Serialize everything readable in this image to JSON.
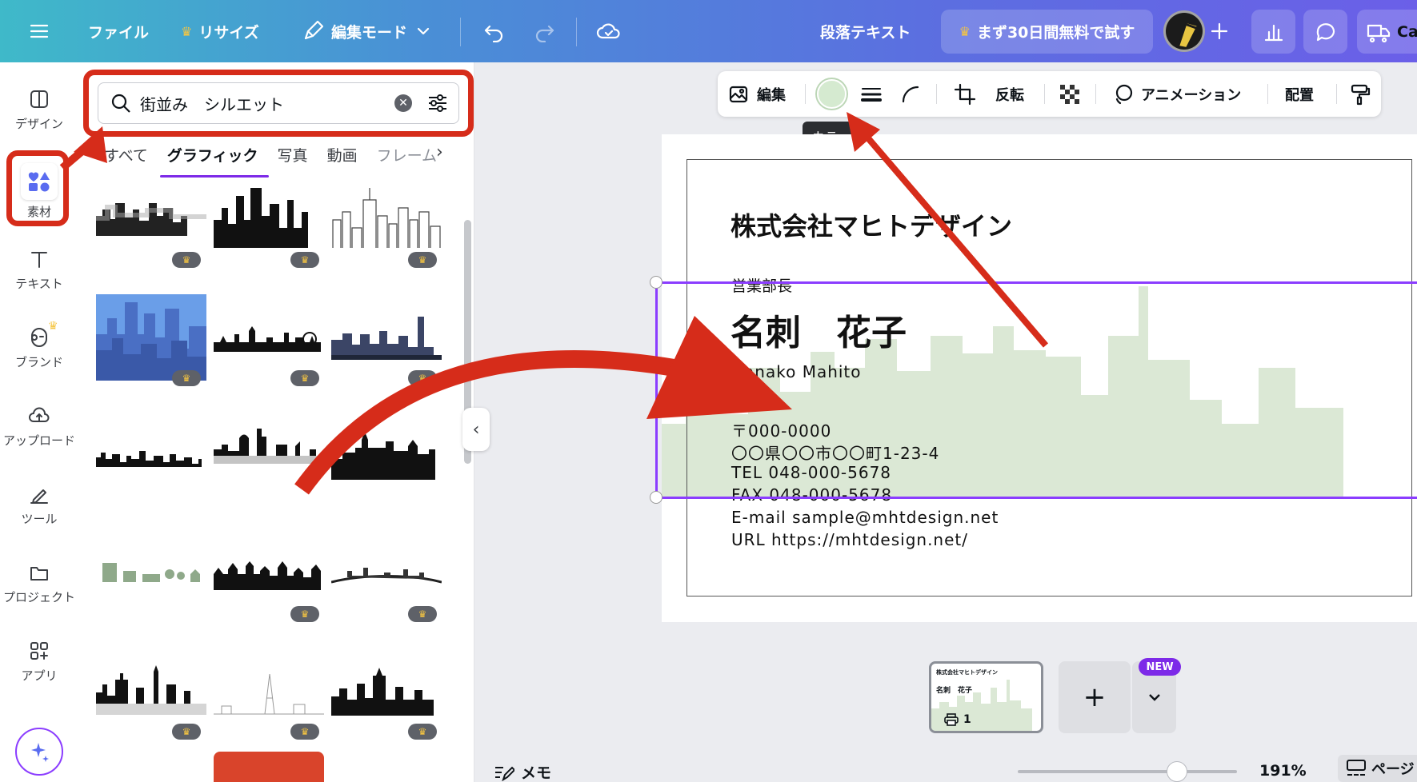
{
  "topbar": {
    "file": "ファイル",
    "resize": "リサイズ",
    "edit_mode": "編集モード",
    "text_type": "段落テキスト",
    "trial": "まず30日間無料で試す",
    "share_truncated": "Ca"
  },
  "rail": [
    {
      "label": "デザイン",
      "icon": "design-icon"
    },
    {
      "label": "素材",
      "icon": "elements-icon"
    },
    {
      "label": "テキスト",
      "icon": "text-icon"
    },
    {
      "label": "ブランド",
      "icon": "brand-icon"
    },
    {
      "label": "アップロード",
      "icon": "upload-icon"
    },
    {
      "label": "ツール",
      "icon": "tools-icon"
    },
    {
      "label": "プロジェクト",
      "icon": "folder-icon"
    },
    {
      "label": "アプリ",
      "icon": "apps-icon"
    }
  ],
  "search": {
    "value": "街並み　シルエット",
    "placeholder": ""
  },
  "tabs": [
    "すべて",
    "グラフィック",
    "写真",
    "動画",
    "フレーム"
  ],
  "context_toolbar": {
    "edit": "編集",
    "flip": "反転",
    "animation": "アニメーション",
    "position": "配置",
    "tooltip": "カラー"
  },
  "card": {
    "company": "株式会社マヒトデザイン",
    "title": "営業部長",
    "name": "名刺　花子",
    "name_en": "Hanako Mahito",
    "postal": "〒000-0000",
    "address": "〇〇県〇〇市〇〇町1-23-4",
    "tel": "TEL  048-000-5678",
    "fax": "FAX  048-000-5678",
    "email": "E-mail sample@mhtdesign.net",
    "url": "URL  https://mhtdesign.net/"
  },
  "thumbnail": {
    "company": "株式会社マヒトデザイン",
    "name": "名刺　花子",
    "page_number": "1"
  },
  "new_badge": "NEW",
  "bottom": {
    "memo": "メモ",
    "zoom": "191%",
    "pages": "ページ",
    "zoom_level_fraction": 0.68
  },
  "colors": {
    "accent": "#8b3dff",
    "annotation": "#d62c1a",
    "silhouette": "#dbe8d5",
    "selected_color": "#d5ead0"
  }
}
